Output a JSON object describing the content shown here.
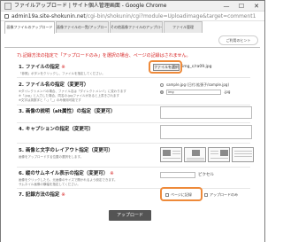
{
  "window": {
    "title": "ファイルアップロード | サイト個人管理画面 - Google Chrome",
    "minimize": "—",
    "maximize": "☐",
    "close": "✕"
  },
  "address": {
    "domain": "admin19a.site-shokunin.net",
    "path": "/cgi-bin/shokunin/cgi?module=Uploadimage&target=comment1"
  },
  "tabs": [
    {
      "label": "画像ファイルのアップロード"
    },
    {
      "label": "画像ファイルの一覧/アップロード"
    },
    {
      "label": "その他画像ファイルのアップロード"
    },
    {
      "label": "ファイル管理"
    }
  ],
  "help": {
    "label": "ご利用のヒント"
  },
  "notice": "7).記録方法の指定で「アップロードのみ」を選択の場合、ページの記録はされません。",
  "fields": {
    "file": {
      "label": "1. ファイルの指定",
      "required": "※",
      "desc": "「参照」ボタンをクリックし、ファイルを指定してください。",
      "button": "ファイルを選択",
      "filename": "img_c/ra09.jpg"
    },
    "filename": {
      "label": "2. ファイル名の指定（変更可）",
      "desc1": "※ダイレクトメンバの場合、ファイル名は「ダイレクトメンバ」に変わります",
      "desc2": "※「.jpg」と入力した場合、同名の.jpgファイルがあると上書きされます",
      "desc3": "※文字は英数字と「-」「_」のみ使用可能です",
      "radio1": "sample.jpg (日付.拡張子/sample.jpg)",
      "radio2": "img",
      "suffix": ".jpg"
    },
    "description": {
      "label": "3. 画像の説明（alt属性）の指定（変更可）"
    },
    "caption": {
      "label": "4. キャプションの指定（変更可）"
    },
    "layout": {
      "label": "5. 画像と文字のレイアウト指定（変更可）",
      "desc": "画像をアップロードする位置の選択をします。"
    },
    "thumb": {
      "label": "6. 縦のサムネイル表示の指定（変更可）",
      "required": "※",
      "desc1": "画像をクリックしたら、元画像のサイズで開かれるよう設定できます。",
      "desc2": "サムネイル画像の横幅を指定してください。",
      "unit": "ピクセル"
    },
    "record": {
      "label": "7. 記録方法の指定",
      "required": "※",
      "option1": "ページに記録",
      "option2": "アップロードのみ"
    }
  },
  "submit": {
    "label": "アップロード"
  },
  "colors": {
    "highlight": "#ee8a3a",
    "notice": "#d62020",
    "button": "#545454"
  }
}
